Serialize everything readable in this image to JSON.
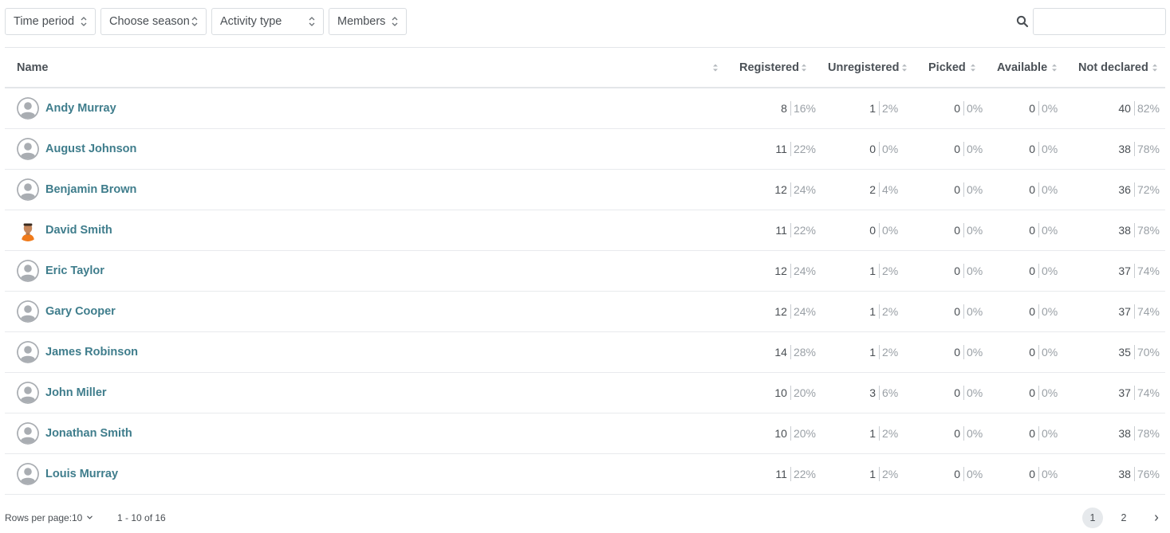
{
  "filters": [
    {
      "label": "Time period"
    },
    {
      "label": "Choose season"
    },
    {
      "label": "Activity type"
    },
    {
      "label": "Members"
    }
  ],
  "search": {
    "value": "",
    "placeholder": ""
  },
  "table": {
    "columns": {
      "name": "Name",
      "registered": "Registered",
      "unregistered": "Unregistered",
      "picked": "Picked",
      "available": "Available",
      "not_declared": "Not declared"
    },
    "rows": [
      {
        "name": "Andy Murray",
        "avatar": "default-avatar-icon",
        "registered": {
          "n": "8",
          "p": "16%"
        },
        "unregistered": {
          "n": "1",
          "p": "2%"
        },
        "picked": {
          "n": "0",
          "p": "0%"
        },
        "available": {
          "n": "0",
          "p": "0%"
        },
        "not_declared": {
          "n": "40",
          "p": "82%"
        }
      },
      {
        "name": "August Johnson",
        "avatar": "default-avatar-icon",
        "registered": {
          "n": "11",
          "p": "22%"
        },
        "unregistered": {
          "n": "0",
          "p": "0%"
        },
        "picked": {
          "n": "0",
          "p": "0%"
        },
        "available": {
          "n": "0",
          "p": "0%"
        },
        "not_declared": {
          "n": "38",
          "p": "78%"
        }
      },
      {
        "name": "Benjamin Brown",
        "avatar": "default-avatar-icon",
        "registered": {
          "n": "12",
          "p": "24%"
        },
        "unregistered": {
          "n": "2",
          "p": "4%"
        },
        "picked": {
          "n": "0",
          "p": "0%"
        },
        "available": {
          "n": "0",
          "p": "0%"
        },
        "not_declared": {
          "n": "36",
          "p": "72%"
        }
      },
      {
        "name": "David Smith",
        "avatar": "person-photo-avatar",
        "registered": {
          "n": "11",
          "p": "22%"
        },
        "unregistered": {
          "n": "0",
          "p": "0%"
        },
        "picked": {
          "n": "0",
          "p": "0%"
        },
        "available": {
          "n": "0",
          "p": "0%"
        },
        "not_declared": {
          "n": "38",
          "p": "78%"
        }
      },
      {
        "name": "Eric Taylor",
        "avatar": "default-avatar-icon",
        "registered": {
          "n": "12",
          "p": "24%"
        },
        "unregistered": {
          "n": "1",
          "p": "2%"
        },
        "picked": {
          "n": "0",
          "p": "0%"
        },
        "available": {
          "n": "0",
          "p": "0%"
        },
        "not_declared": {
          "n": "37",
          "p": "74%"
        }
      },
      {
        "name": "Gary Cooper",
        "avatar": "default-avatar-icon",
        "registered": {
          "n": "12",
          "p": "24%"
        },
        "unregistered": {
          "n": "1",
          "p": "2%"
        },
        "picked": {
          "n": "0",
          "p": "0%"
        },
        "available": {
          "n": "0",
          "p": "0%"
        },
        "not_declared": {
          "n": "37",
          "p": "74%"
        }
      },
      {
        "name": "James Robinson",
        "avatar": "default-avatar-icon",
        "registered": {
          "n": "14",
          "p": "28%"
        },
        "unregistered": {
          "n": "1",
          "p": "2%"
        },
        "picked": {
          "n": "0",
          "p": "0%"
        },
        "available": {
          "n": "0",
          "p": "0%"
        },
        "not_declared": {
          "n": "35",
          "p": "70%"
        }
      },
      {
        "name": "John Miller",
        "avatar": "default-avatar-icon",
        "registered": {
          "n": "10",
          "p": "20%"
        },
        "unregistered": {
          "n": "3",
          "p": "6%"
        },
        "picked": {
          "n": "0",
          "p": "0%"
        },
        "available": {
          "n": "0",
          "p": "0%"
        },
        "not_declared": {
          "n": "37",
          "p": "74%"
        }
      },
      {
        "name": "Jonathan Smith",
        "avatar": "default-avatar-icon",
        "registered": {
          "n": "10",
          "p": "20%"
        },
        "unregistered": {
          "n": "1",
          "p": "2%"
        },
        "picked": {
          "n": "0",
          "p": "0%"
        },
        "available": {
          "n": "0",
          "p": "0%"
        },
        "not_declared": {
          "n": "38",
          "p": "78%"
        }
      },
      {
        "name": "Louis Murray",
        "avatar": "default-avatar-icon",
        "registered": {
          "n": "11",
          "p": "22%"
        },
        "unregistered": {
          "n": "1",
          "p": "2%"
        },
        "picked": {
          "n": "0",
          "p": "0%"
        },
        "available": {
          "n": "0",
          "p": "0%"
        },
        "not_declared": {
          "n": "38",
          "p": "76%"
        }
      }
    ]
  },
  "footer": {
    "rows_per_page_label": "Rows per page:",
    "rows_per_page_value": "10",
    "range": "1 - 10 of 16",
    "pages": [
      "1",
      "2"
    ],
    "current_page": "1",
    "next_icon": "chevron-right-icon"
  },
  "colors": {
    "name_link": "#3f7d8c",
    "border": "#e3e6e9",
    "active_page": "#e6e9ec"
  }
}
